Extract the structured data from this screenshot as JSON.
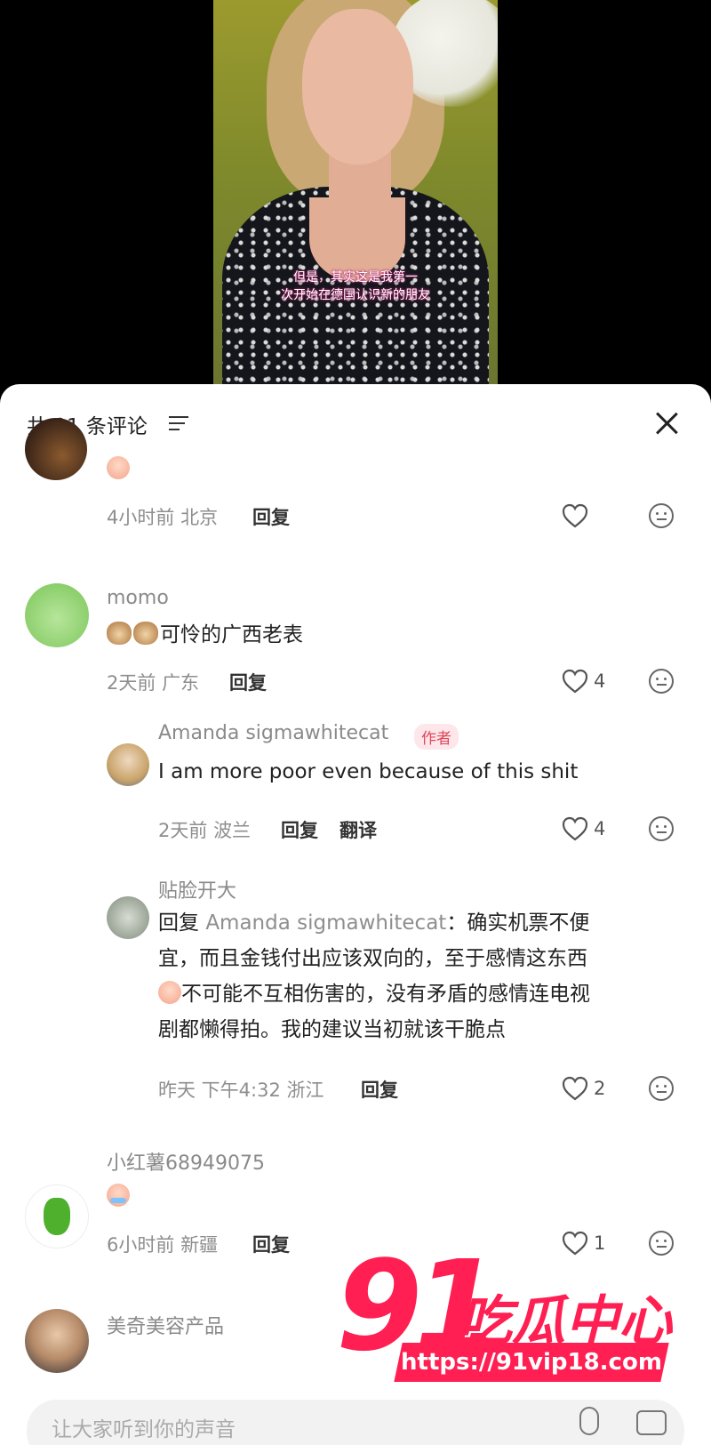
{
  "video": {
    "subtitle_line1": "但是，其实这是我第一",
    "subtitle_line2": "次开始在德国认识新的朋友"
  },
  "sheet": {
    "count_label": "共 91 条评论",
    "input_placeholder": "让大家听到你的声音"
  },
  "comments": [
    {
      "text": "",
      "time": "4小时前",
      "location": "北京",
      "reply_label": "回复",
      "likes": ""
    },
    {
      "username": "momo",
      "text": "可怜的广西老表",
      "time": "2天前",
      "location": "广东",
      "reply_label": "回复",
      "likes": "4"
    },
    {
      "username": "Amanda sigmawhitecat",
      "author_tag": "作者",
      "text": "I am more poor even because of this shit",
      "time": "2天前",
      "location": "波兰",
      "reply_label": "回复",
      "translate_label": "翻译",
      "likes": "4"
    },
    {
      "username": "贴脸开大",
      "reply_prefix": "回复",
      "reply_target": "Amanda sigmawhitecat",
      "text_line1": "：确实机票不便",
      "text_line2": "宜，而且金钱付出应该双向的，至于感情这东西",
      "text_line3": "不可能不互相伤害的，没有矛盾的感情连电视",
      "text_line4": "剧都懒得拍。我的建议当初就该干脆点",
      "time": "昨天 下午4:32",
      "location": "浙江",
      "reply_label": "回复",
      "likes": "2"
    },
    {
      "username": "小红薯68949075",
      "text": "",
      "time": "6小时前",
      "location": "新疆",
      "reply_label": "回复",
      "likes": "1"
    },
    {
      "username": "美奇美容产品"
    }
  ],
  "watermark": {
    "number": "91",
    "brand": "吃瓜中心",
    "url": "https://91vip18.com"
  }
}
